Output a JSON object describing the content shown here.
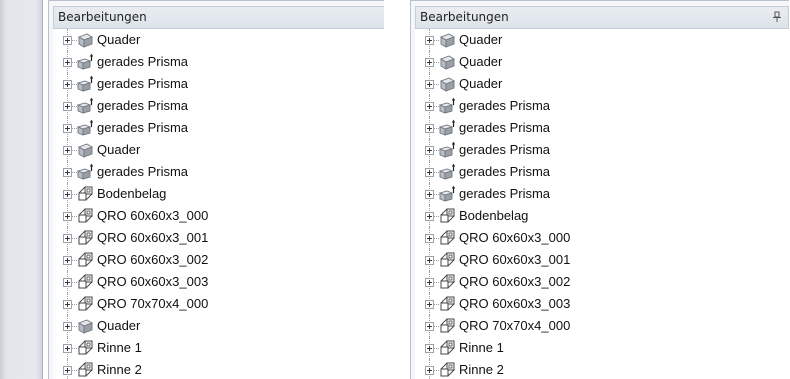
{
  "left_panel": {
    "title": "Bearbeitungen",
    "items": [
      {
        "label": "Quader",
        "icon": "cube-icon"
      },
      {
        "label": "gerades Prisma",
        "icon": "prism-icon"
      },
      {
        "label": "gerades Prisma",
        "icon": "prism-icon"
      },
      {
        "label": "gerades Prisma",
        "icon": "prism-icon"
      },
      {
        "label": "gerades Prisma",
        "icon": "prism-icon"
      },
      {
        "label": "Quader",
        "icon": "cube-icon"
      },
      {
        "label": "gerades Prisma",
        "icon": "prism-icon"
      },
      {
        "label": "Bodenbelag",
        "icon": "assembly-icon"
      },
      {
        "label": "QRO 60x60x3_000",
        "icon": "assembly-icon"
      },
      {
        "label": "QRO 60x60x3_001",
        "icon": "assembly-icon"
      },
      {
        "label": "QRO 60x60x3_002",
        "icon": "assembly-icon"
      },
      {
        "label": "QRO 60x60x3_003",
        "icon": "assembly-icon"
      },
      {
        "label": "QRO 70x70x4_000",
        "icon": "assembly-icon"
      },
      {
        "label": "Quader",
        "icon": "cube-icon"
      },
      {
        "label": "Rinne 1",
        "icon": "assembly-icon"
      },
      {
        "label": "Rinne 2",
        "icon": "assembly-icon"
      }
    ]
  },
  "right_panel": {
    "title": "Bearbeitungen",
    "pin_icon": "pin-icon",
    "items": [
      {
        "label": "Quader",
        "icon": "cube-icon"
      },
      {
        "label": "Quader",
        "icon": "cube-icon"
      },
      {
        "label": "Quader",
        "icon": "cube-icon"
      },
      {
        "label": "gerades Prisma",
        "icon": "prism-icon"
      },
      {
        "label": "gerades Prisma",
        "icon": "prism-icon"
      },
      {
        "label": "gerades Prisma",
        "icon": "prism-icon"
      },
      {
        "label": "gerades Prisma",
        "icon": "prism-icon"
      },
      {
        "label": "gerades Prisma",
        "icon": "prism-icon"
      },
      {
        "label": "Bodenbelag",
        "icon": "assembly-icon"
      },
      {
        "label": "QRO 60x60x3_000",
        "icon": "assembly-icon"
      },
      {
        "label": "QRO 60x60x3_001",
        "icon": "assembly-icon"
      },
      {
        "label": "QRO 60x60x3_002",
        "icon": "assembly-icon"
      },
      {
        "label": "QRO 60x60x3_003",
        "icon": "assembly-icon"
      },
      {
        "label": "QRO 70x70x4_000",
        "icon": "assembly-icon"
      },
      {
        "label": "Rinne 1",
        "icon": "assembly-icon"
      },
      {
        "label": "Rinne 2",
        "icon": "assembly-icon"
      }
    ]
  },
  "colors": {
    "panel_background": "#f4f6f9",
    "titlebar_background": "#e3e8ee",
    "tree_background": "#ffffff",
    "icon_gray": "#8a9098",
    "icon_highlight": "#d9dde2"
  }
}
